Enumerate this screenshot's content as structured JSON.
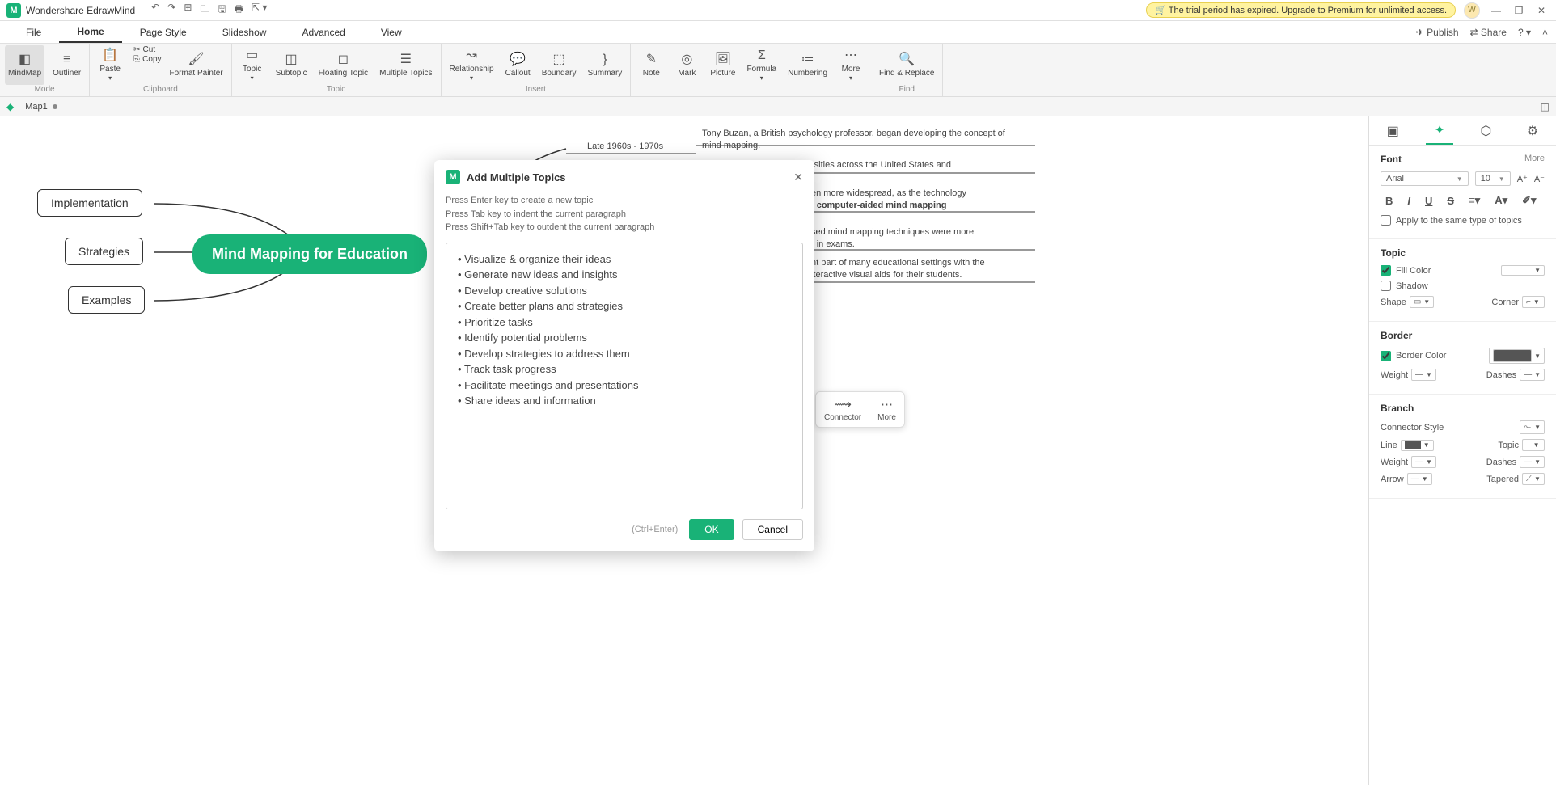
{
  "app": {
    "name": "Wondershare EdrawMind"
  },
  "trial_banner": "🛒 The trial period has expired. Upgrade to Premium for unlimited access.",
  "avatar_letter": "W",
  "menu": {
    "tabs": [
      "File",
      "Home",
      "Page Style",
      "Slideshow",
      "Advanced",
      "View"
    ],
    "active": "Home",
    "right": {
      "publish": "Publish",
      "share": "Share"
    }
  },
  "ribbon": {
    "mode": {
      "mindmap": "MindMap",
      "outliner": "Outliner",
      "label": "Mode"
    },
    "clipboard": {
      "paste": "Paste",
      "cut": "Cut",
      "copy": "Copy",
      "painter": "Format Painter",
      "label": "Clipboard"
    },
    "topic": {
      "topic": "Topic",
      "subtopic": "Subtopic",
      "floating": "Floating Topic",
      "multiple": "Multiple Topics",
      "label": "Topic"
    },
    "insert": {
      "relationship": "Relationship",
      "callout": "Callout",
      "boundary": "Boundary",
      "summary": "Summary",
      "note": "Note",
      "mark": "Mark",
      "picture": "Picture",
      "formula": "Formula",
      "numbering": "Numbering",
      "more": "More",
      "label": "Insert"
    },
    "find": {
      "findreplace": "Find & Replace",
      "label": "Find"
    }
  },
  "doctab": {
    "name": "Map1"
  },
  "canvas": {
    "main": "Mind Mapping for Education",
    "impl": "Implementation",
    "strat": "Strategies",
    "examp": "Examples",
    "period": "Late 1960s - 1970s",
    "text1": "Tony Buzan, a British psychology professor, began developing the concept of mind mapping.",
    "text2": "rsities across the United States and",
    "text3a": "en more widespread, as the technology",
    "text3b": "f computer-aided mind mapping",
    "text4a": "sed mind mapping techniques were more",
    "text4b": "r in exams.",
    "text5a": "nt part of many educational settings with the",
    "text5b": "iteractive visual aids for their students."
  },
  "float_toolbar": {
    "connector": "Connector",
    "more": "More"
  },
  "dialog": {
    "title": "Add Multiple Topics",
    "hints": [
      "Press Enter key to create a new topic",
      "Press Tab key to indent the current paragraph",
      "Press Shift+Tab key to outdent the current paragraph"
    ],
    "items": [
      "Visualize & organize their ideas",
      "Generate new ideas and insights",
      "Develop creative solutions",
      "Create better plans and strategies",
      "Prioritize tasks",
      "Identify potential problems",
      "Develop strategies to address them",
      "Track task progress",
      "Facilitate meetings and presentations",
      "Share ideas and information"
    ],
    "shortcut": "(Ctrl+Enter)",
    "ok": "OK",
    "cancel": "Cancel"
  },
  "sidepanel": {
    "font": {
      "title": "Font",
      "more": "More",
      "family": "Arial",
      "size": "10",
      "apply_same": "Apply to the same type of topics"
    },
    "topic": {
      "title": "Topic",
      "fill": "Fill Color",
      "shadow": "Shadow",
      "shape": "Shape",
      "corner": "Corner"
    },
    "border": {
      "title": "Border",
      "color": "Border Color",
      "weight": "Weight",
      "dashes": "Dashes"
    },
    "branch": {
      "title": "Branch",
      "connector": "Connector Style",
      "line": "Line",
      "topic": "Topic",
      "weight": "Weight",
      "dashes": "Dashes",
      "arrow": "Arrow",
      "tapered": "Tapered"
    }
  }
}
